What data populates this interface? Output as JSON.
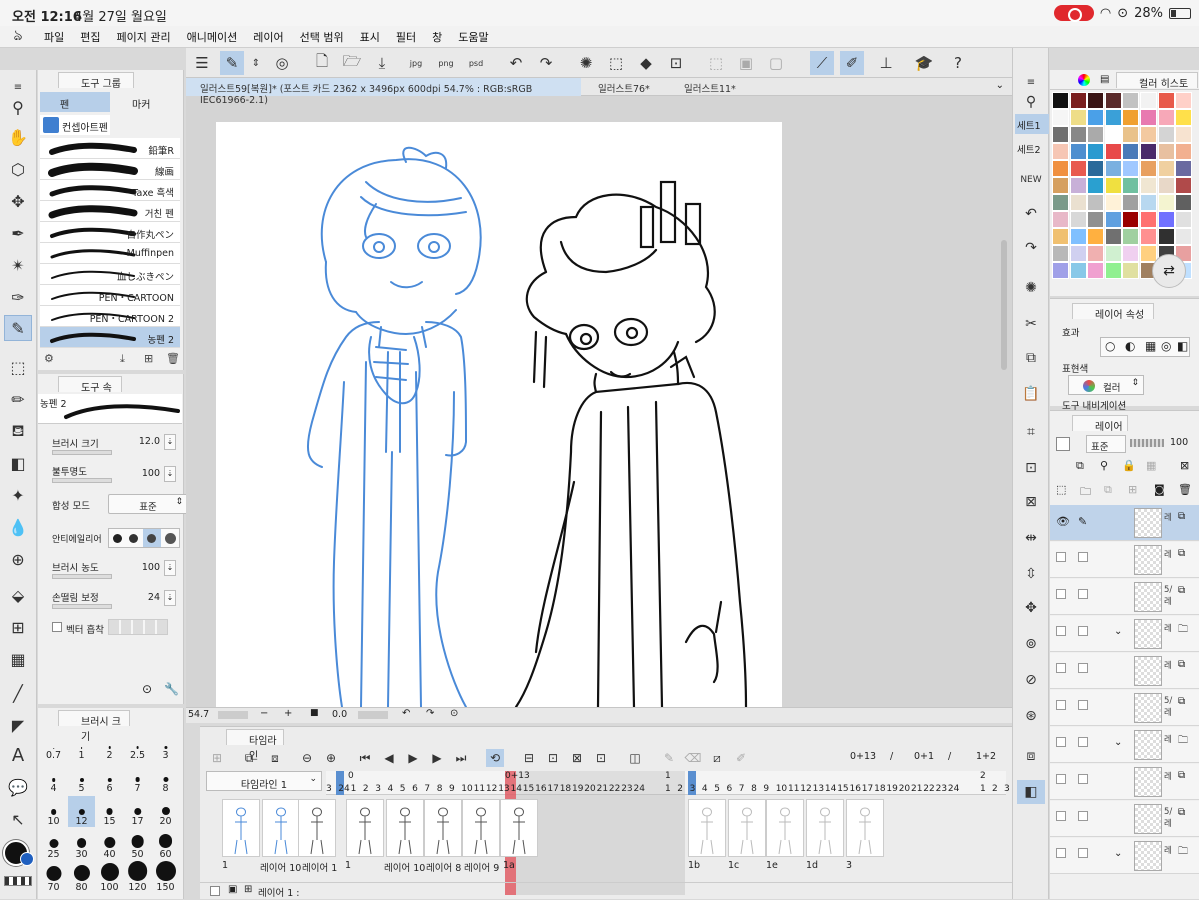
{
  "status": {
    "time": "오전 12:16",
    "date": "4월 27일 월요일",
    "battery": "28%"
  },
  "menu": [
    "파일",
    "편집",
    "페이지 관리",
    "애니메이션",
    "레이어",
    "선택 범위",
    "표시",
    "필터",
    "창",
    "도움말"
  ],
  "doc_tabs": [
    "일러스트59[복원]* (포스트 카드 2362 x 3496px 600dpi 54.7% : RGB:sRGB IEC61966-2.1)",
    "일러스트76*",
    "일러스트11*"
  ],
  "subtool": {
    "group_title": "도구 그룹",
    "tabs": [
      "펜",
      "마커"
    ],
    "set_label": "컨셉아트펜",
    "brushes": [
      "鉛筆R",
      "線画",
      "Taxe 흑색",
      "거친 펜",
      "自作丸ペン",
      "Muffinpen",
      "血しぶきペン",
      "PEN・CARTOON",
      "PEN・CARTOON 2",
      "농펜 2"
    ],
    "selected_brush": "농펜 2"
  },
  "toolprop": {
    "title": "도구 속성",
    "brush_name": "농펜 2",
    "brush_size_label": "브러시 크기",
    "brush_size": "12.0",
    "opacity_label": "불투명도",
    "opacity": "100",
    "blend_label": "합성 모드",
    "blend": "표준",
    "antialias_label": "안티에일리어",
    "density_label": "브러시 농도",
    "density": "100",
    "stabilize_label": "손떨림 보정",
    "stabilize": "24",
    "vector_label": "벡터 흡착"
  },
  "brushsize_panel": {
    "title": "브러시 크기",
    "sizes": [
      "0.7",
      "1",
      "2",
      "2.5",
      "3",
      "4",
      "5",
      "6",
      "7",
      "8",
      "10",
      "12",
      "15",
      "17",
      "20",
      "25",
      "30",
      "40",
      "50",
      "60",
      "70",
      "80",
      "100",
      "120",
      "150"
    ],
    "selected": "12"
  },
  "navigator": {
    "zoom": "54.7",
    "angle": "0.0"
  },
  "timeline": {
    "title": "타임라인",
    "name": "타임라인 1",
    "counter_a": "0+13",
    "sep": "/",
    "counter_b": "0+1",
    "counter_c": "1+2",
    "marker_1": "0",
    "marker_2": "0+13",
    "marker_3": "1",
    "marker_4": "2",
    "ruler_a": [
      "3",
      "24",
      "1",
      "2",
      "3",
      "4",
      "5",
      "6",
      "7",
      "8",
      "9",
      "10",
      "11",
      "12",
      "13",
      "14",
      "15",
      "16",
      "17",
      "18",
      "19",
      "20",
      "21",
      "22",
      "23",
      "24"
    ],
    "ruler_b": [
      "1",
      "2",
      "3",
      "4",
      "5",
      "6",
      "7",
      "8",
      "9",
      "10",
      "11",
      "12",
      "13",
      "14",
      "15",
      "16",
      "17",
      "18",
      "19",
      "20",
      "21",
      "22",
      "23",
      "24"
    ],
    "ruler_c": [
      "1",
      "2",
      "3"
    ],
    "cel_labels": [
      "1",
      "레이어 10",
      "레이어 1",
      "1",
      "레이어 10",
      "레이어 8",
      "레이어 9",
      "1a",
      "1b",
      "1c",
      "1e",
      "1d",
      "3"
    ],
    "layer_row_label": "레이어 1 :"
  },
  "colorset": {
    "title": "컬러 히스토",
    "sets": [
      "세트1",
      "세트2"
    ],
    "swatches": [
      "#111111",
      "#7a1e1e",
      "#3a1414",
      "#5a2a2a",
      "#c2c2c2",
      "#f2f2f2",
      "#e85a4a",
      "#ffd0c8",
      "#f6f6f6",
      "#eedd88",
      "#4aa0e8",
      "#3aa0d8",
      "#f0a030",
      "#e87ab0",
      "#f7a8b8",
      "#ffe04a",
      "#6f6f6f",
      "#888888",
      "#aaaaaa",
      "#ffffff",
      "#e9c28a",
      "#f3c9a0",
      "#d4d4d4",
      "#f7e3d0",
      "#f6c6b4",
      "#4f8fcf",
      "#2a9ad0",
      "#e84a4a",
      "#4a7ab8",
      "#4a2a6a",
      "#e8c0a0",
      "#f2b090",
      "#f09040",
      "#e85a50",
      "#2a6a9a",
      "#7ab0e0",
      "#a0c8ff",
      "#e8a060",
      "#f0d0a0",
      "#6a6aa0",
      "#d6a060",
      "#c8b0d8",
      "#2aa0d0",
      "#f0e040",
      "#70c0a0",
      "#f0e6d2",
      "#e8d8c8",
      "#b04a4a",
      "#7a9a8a",
      "#eae0d0",
      "#c0c0c0",
      "#fff2d8",
      "#a0a0a0",
      "#b8d8f0",
      "#f4f4d0",
      "#606060",
      "#e8b8c8",
      "#d8d8d8",
      "#909090",
      "#60a0e0",
      "#9a0000",
      "#ff7070",
      "#7070ff",
      "#e0e0e0",
      "#f0c070",
      "#80c0ff",
      "#ffb040",
      "#707070",
      "#a0d0a0",
      "#ff9090",
      "#303030",
      "#e8e8e8",
      "#b8b8b8",
      "#d0d0f0",
      "#f0b0b0",
      "#d0f0d0",
      "#f0d0f0",
      "#ffd080",
      "#404040",
      "#e8a0a0",
      "#a0a0e8",
      "#88c8e8",
      "#f0a0d0",
      "#90f090",
      "#e0e0a0",
      "#a08060",
      "#f08040",
      "#c0e0ff",
      "#ffd0d0",
      "#60c060",
      "#e0a060",
      "#c0c0e0",
      "#ff9060",
      "#d0a080",
      "#ffa0a0",
      "#8080c0",
      "#f0f080",
      "#80f0f0",
      "#c0f0c0",
      "#404080",
      "#a04040",
      "#e060a0",
      "#40a0a0",
      "#ffe0a0"
    ]
  },
  "layerprop": {
    "title": "레이어 속성",
    "effect_label": "효과",
    "expr_label": "표현색",
    "expr_value": "컬러",
    "nav_label": "도구 내비게이션"
  },
  "layers": {
    "title": "레이어",
    "blend": "표준",
    "opacity": "100",
    "row_labels": [
      "레",
      "레",
      "5/레",
      "레",
      "레",
      "5/레",
      "레",
      "레",
      "5/레",
      "레"
    ]
  }
}
